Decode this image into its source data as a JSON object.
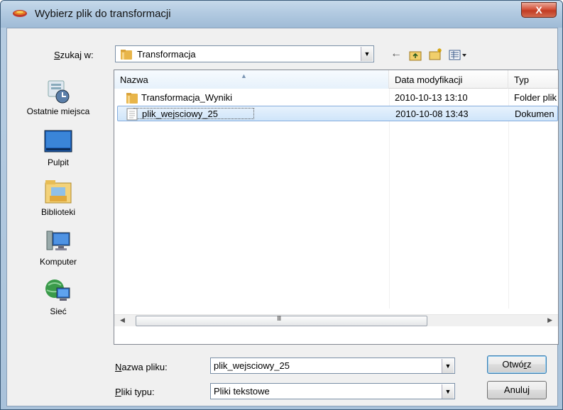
{
  "window": {
    "title": "Wybierz plik do transformacji",
    "close_label": "X"
  },
  "toolbar": {
    "lookin_label_prefix": "",
    "lookin_label_accel": "S",
    "lookin_label_rest": "zukaj w:",
    "lookin_value": "Transformacja",
    "back_icon": "back-arrow-icon",
    "up_icon": "up-folder-icon",
    "new_folder_icon": "new-folder-icon",
    "views_icon": "views-menu-icon"
  },
  "places": [
    {
      "label": "Ostatnie miejsca",
      "icon": "recent-places-icon"
    },
    {
      "label": "Pulpit",
      "icon": "desktop-icon"
    },
    {
      "label": "Biblioteki",
      "icon": "libraries-icon"
    },
    {
      "label": "Komputer",
      "icon": "computer-icon"
    },
    {
      "label": "Sieć",
      "icon": "network-icon"
    }
  ],
  "filelist": {
    "columns": [
      "Nazwa",
      "Data modyfikacji",
      "Typ"
    ],
    "rows": [
      {
        "name": "Transformacja_Wyniki",
        "date": "2010-10-13 13:10",
        "type": "Folder plik",
        "icon": "folder-icon",
        "selected": false
      },
      {
        "name": "plik_wejsciowy_25",
        "date": "2010-10-08 13:43",
        "type": "Dokumen",
        "icon": "text-document-icon",
        "selected": true
      }
    ],
    "scroll_grip": "III"
  },
  "filename": {
    "label_accel": "N",
    "label_rest": "azwa pliku:",
    "value": "plik_wejsciowy_25"
  },
  "filetype": {
    "label_accel": "P",
    "label_rest": "liki typu:",
    "value": "Pliki tekstowe"
  },
  "buttons": {
    "open_label_pre": "Otwó",
    "open_label_accel": "r",
    "open_label_post": "z",
    "cancel_label": "Anuluj"
  },
  "colors": {
    "selection": "#cfe5fa",
    "title_gradient": "#b2cae1",
    "close_red": "#c13b22"
  }
}
